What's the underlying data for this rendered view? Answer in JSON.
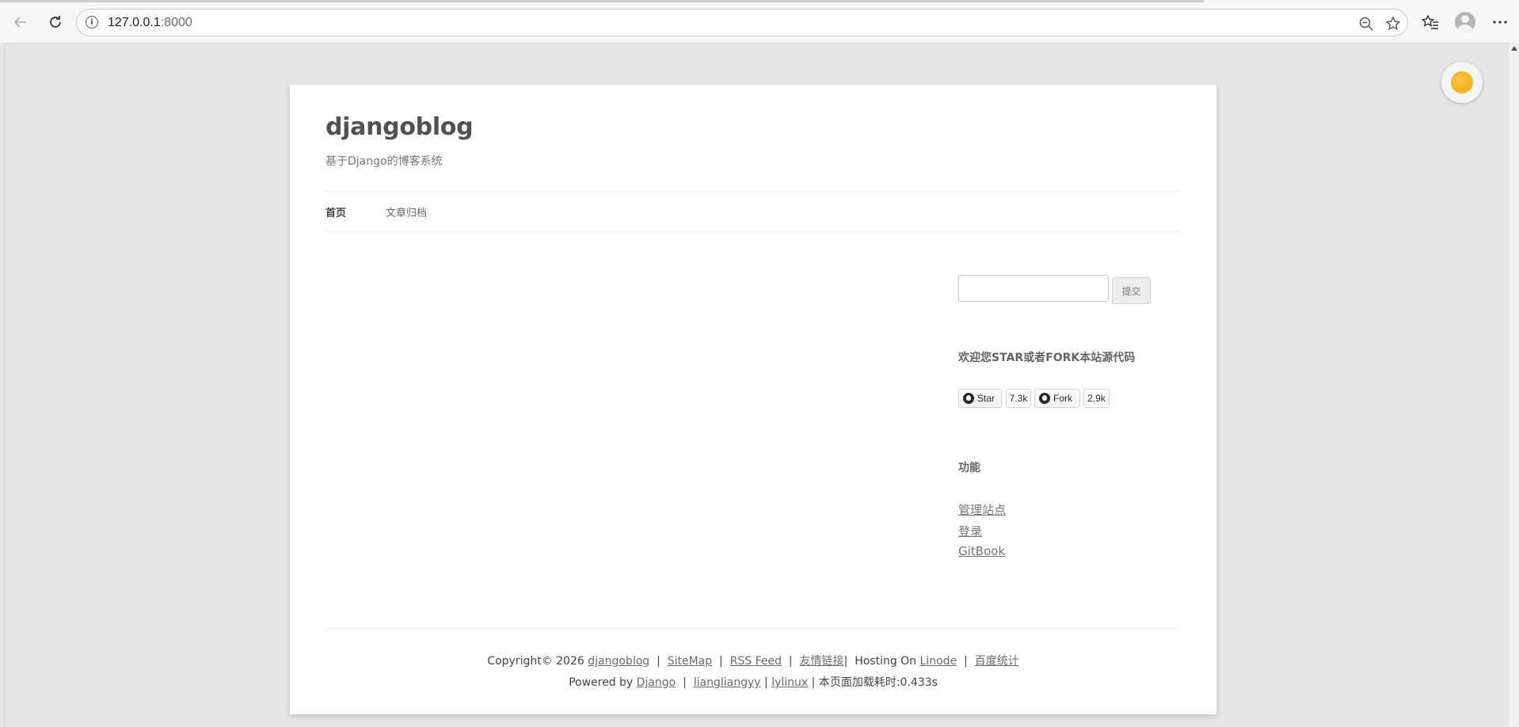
{
  "browser": {
    "url_host": "127.0.0.1",
    "url_port": ":8000",
    "icons": [
      "back-icon",
      "reload-icon",
      "site-info-icon",
      "zoom-out-icon",
      "favorite-star-icon",
      "favorites-icon",
      "profile-icon",
      "more-icon"
    ]
  },
  "site": {
    "title": "djangoblog",
    "description": "基于Django的博客系统"
  },
  "nav": {
    "items": [
      {
        "label": "首页",
        "current": true
      },
      {
        "label": "文章归档",
        "current": false
      }
    ]
  },
  "sidebar": {
    "search_button": "提交",
    "github_widget": {
      "title": "欢迎您STAR或者FORK本站源代码",
      "star_label": "Star",
      "star_count": "7.3k",
      "fork_label": "Fork",
      "fork_count": "2.9k"
    },
    "func_widget": {
      "title": "功能",
      "links": [
        "管理站点",
        "登录",
        "GitBook"
      ]
    }
  },
  "footer": {
    "copyright": "Copyright© 2026",
    "site_link": "djangoblog",
    "sitemap": "SiteMap",
    "rss": "RSS Feed",
    "friends": "友情链接",
    "hosting_on": "Hosting On",
    "linode": "Linode",
    "baidu": "百度统计",
    "powered_by": "Powered by",
    "django": "Django",
    "author1": "liangliangyy",
    "author2": "lylinux",
    "load_time": "本页面加载耗时:0.433s"
  },
  "colors": {
    "page_bg": "#e6e6e6",
    "content_bg": "#ffffff",
    "link": "#6a6a6a",
    "theme_toggle_sun": "#f6b21b"
  }
}
